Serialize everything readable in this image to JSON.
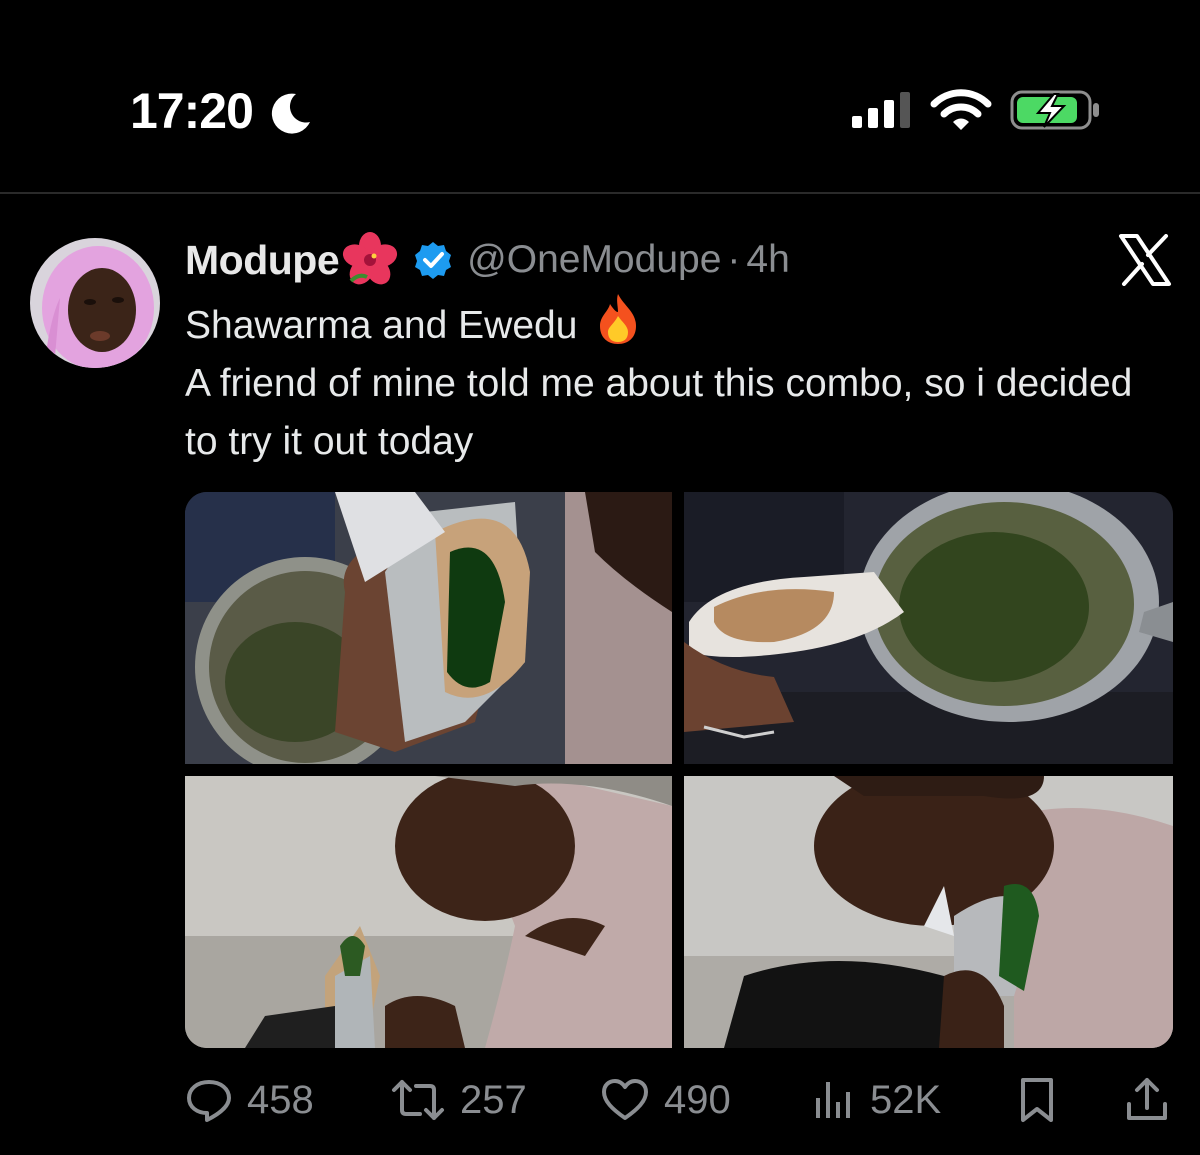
{
  "status_bar": {
    "time": "17:20",
    "icons": [
      "moon-icon",
      "cellular-signal-icon",
      "wifi-icon",
      "battery-charging-icon"
    ],
    "battery_color": "#4cd964"
  },
  "tweet": {
    "display_name": "Modupe",
    "name_emoji": "hibiscus-icon",
    "verified": true,
    "verified_color": "#1d9bf0",
    "handle": "@OneModupe",
    "separator": "·",
    "age": "4h",
    "text_line_1": "Shawarma and Ewedu",
    "text_line_1_emoji": "fire-icon",
    "text_rest": "A friend of mine told me about this combo, so i decided to try it out today",
    "media": [
      {
        "name": "photo-shawarma-over-ewedu-pot"
      },
      {
        "name": "photo-shawarma-and-pot-of-ewedu"
      },
      {
        "name": "photo-woman-holding-shawarma"
      },
      {
        "name": "photo-woman-eating-shawarma"
      }
    ],
    "stats": {
      "replies": "458",
      "reposts": "257",
      "likes": "490",
      "views": "52K"
    }
  }
}
